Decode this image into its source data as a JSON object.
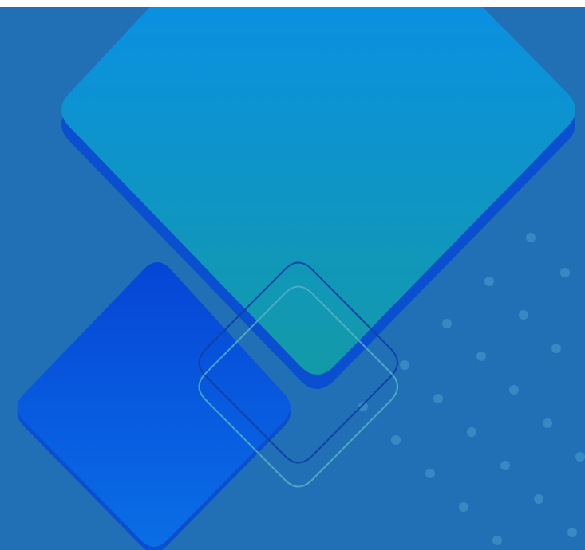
{
  "colors": {
    "background": "#2170b5",
    "large_diamond_top": "#0a90e2",
    "large_diamond_bottom": "#139aa8",
    "large_diamond_shadow": "#0a4fcf",
    "small_diamond_top": "#0645d6",
    "small_diamond_bottom": "#0a6ee6",
    "outline_dark": "#0d43a8",
    "outline_light": "#58b4c8",
    "dots": "#3a8fc6"
  },
  "shapes": {
    "large_diamond": "rounded-diamond-filled",
    "small_diamond": "rounded-diamond-filled",
    "outline_diamond_dark": "rounded-diamond-outline",
    "outline_diamond_light": "rounded-diamond-outline",
    "dot_grid": "diagonal-dot-pattern"
  }
}
